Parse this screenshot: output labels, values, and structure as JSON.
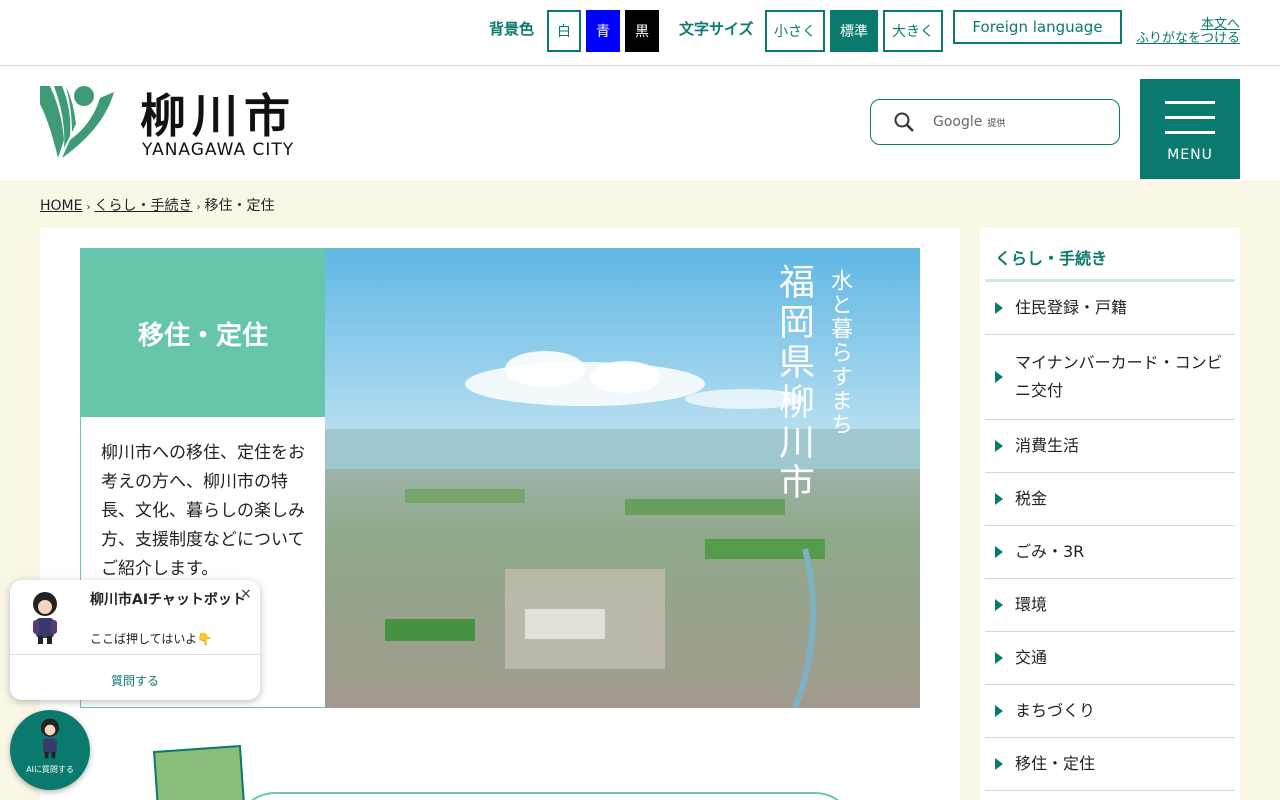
{
  "topbar": {
    "bg_color_label": "背景色",
    "bg_white": "白",
    "bg_blue": "青",
    "bg_black": "黒",
    "font_size_label": "文字サイズ",
    "font_small": "小さく",
    "font_standard": "標準",
    "font_large": "大きく",
    "foreign_language": "Foreign language",
    "skip_to_content": "本文へ",
    "furigana": "ふりがなをつける"
  },
  "header": {
    "logo_title": "柳川市",
    "logo_subtitle": "YANAGAWA CITY",
    "search_placeholder": "Google",
    "search_provider": "提供",
    "menu_label": "MENU"
  },
  "breadcrumb": {
    "home": "HOME",
    "category": "くらし・手続き",
    "current": "移住・定住"
  },
  "hero": {
    "title": "移住・定住",
    "description": "柳川市への移住、定住をお考えの方へ、柳川市の特長、文化、暮らしの楽しみ方、支援制度などについてご紹介します。",
    "vertical_main": "福岡県柳川市",
    "vertical_tagline": "水と暮らすまち"
  },
  "sidebar": {
    "title": "くらし・手続き",
    "items": [
      {
        "label": "住民登録・戸籍"
      },
      {
        "label": "マイナンバーカード・コンビニ交付"
      },
      {
        "label": "消費生活"
      },
      {
        "label": "税金"
      },
      {
        "label": "ごみ・3R"
      },
      {
        "label": "環境"
      },
      {
        "label": "交通"
      },
      {
        "label": "まちづくり"
      },
      {
        "label": "移住・定住"
      }
    ]
  },
  "chatbot": {
    "title": "柳川市AIチャットボット",
    "message": "ここば押してはいよ👇",
    "close": "×",
    "ask_button": "質問する",
    "fab_label": "AIに質問する"
  },
  "colors": {
    "brand": "#0b7a6e",
    "hero_accent": "#66c6ac",
    "content_background": "#faf7e6"
  }
}
